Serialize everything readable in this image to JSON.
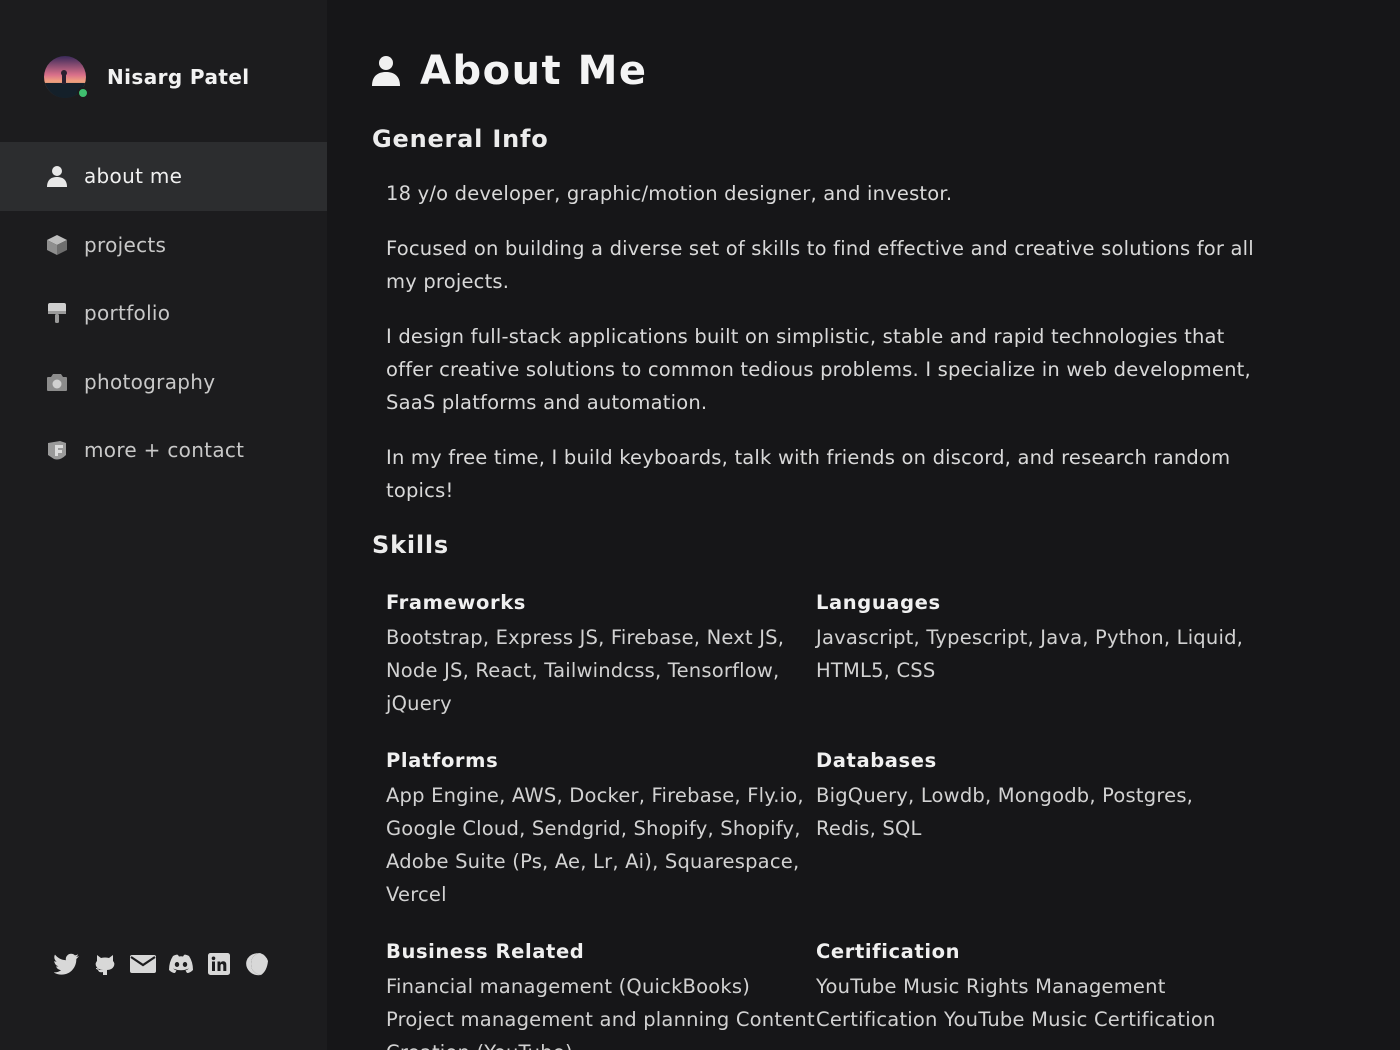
{
  "profile": {
    "name": "Nisarg Patel"
  },
  "nav": {
    "items": [
      {
        "label": "about me",
        "icon": "user-icon"
      },
      {
        "label": "projects",
        "icon": "cube-icon"
      },
      {
        "label": "portfolio",
        "icon": "paint-brush-icon"
      },
      {
        "label": "photography",
        "icon": "camera-icon"
      },
      {
        "label": "more + contact",
        "icon": "id-card-icon"
      }
    ],
    "active_index": 0
  },
  "socials": [
    {
      "icon": "twitter-icon"
    },
    {
      "icon": "github-icon"
    },
    {
      "icon": "email-icon"
    },
    {
      "icon": "discord-icon"
    },
    {
      "icon": "linkedin-icon"
    },
    {
      "icon": "moon-icon"
    }
  ],
  "page": {
    "title": "About Me",
    "icon": "user-icon"
  },
  "general_info": {
    "heading": "General Info",
    "paragraphs": [
      "18 y/o developer, graphic/motion designer, and investor.",
      "Focused on building a diverse set of skills to find effective and creative solutions for all my projects.",
      "I design full-stack applications built on simplistic, stable and rapid technologies that offer creative solutions to common tedious problems. I specialize in web development, SaaS platforms and automation.",
      "In my free time, I build keyboards, talk with friends on discord, and research random topics!"
    ]
  },
  "skills": {
    "heading": "Skills",
    "groups": [
      {
        "title": "Frameworks",
        "list": "Bootstrap, Express JS, Firebase, Next JS, Node JS, React, Tailwindcss, Tensorflow, jQuery"
      },
      {
        "title": "Languages",
        "list": "Javascript, Typescript, Java, Python, Liquid, HTML5, CSS"
      },
      {
        "title": "Platforms",
        "list": "App Engine, AWS, Docker, Firebase, Fly.io, Google Cloud, Sendgrid, Shopify, Shopify, Adobe Suite (Ps, Ae, Lr, Ai), Squarespace, Vercel"
      },
      {
        "title": "Databases",
        "list": "BigQuery, Lowdb, Mongodb, Postgres, Redis, SQL"
      },
      {
        "title": "Business Related",
        "list": "Financial management (QuickBooks) Project management and planning Content Creation (YouTube)"
      },
      {
        "title": "Certification",
        "list": "YouTube Music Rights Management Certification YouTube Music Certification"
      }
    ]
  },
  "colors": {
    "background": "#161618",
    "sidebar": "#1c1c1e",
    "active_item": "#2c2d2f",
    "online": "#3fbf6f"
  }
}
